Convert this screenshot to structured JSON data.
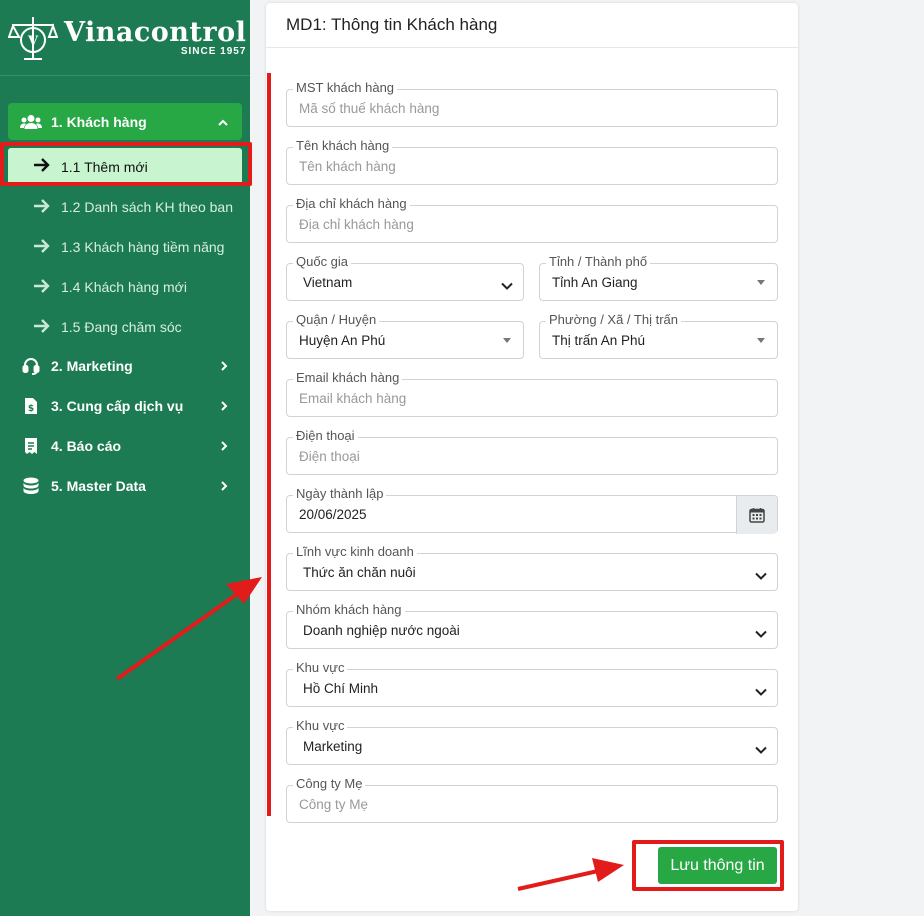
{
  "brand": {
    "name": "Vinacontrol",
    "since": "SINCE 1957"
  },
  "sidebar": {
    "groups": [
      {
        "label": "1. Khách hàng",
        "icon": "users-icon",
        "expanded": true
      },
      {
        "label": "2. Marketing",
        "icon": "headset-icon"
      },
      {
        "label": "3. Cung cấp dịch vụ",
        "icon": "invoice-icon"
      },
      {
        "label": "4. Báo cáo",
        "icon": "receipt-icon"
      },
      {
        "label": "5. Master Data",
        "icon": "database-icon"
      }
    ],
    "subitems": [
      {
        "label": "1.1 Thêm mới",
        "active": true
      },
      {
        "label": "1.2 Danh sách KH theo ban"
      },
      {
        "label": "1.3 Khách hàng tiềm năng"
      },
      {
        "label": "1.4 Khách hàng mới"
      },
      {
        "label": "1.5 Đang chăm sóc"
      }
    ]
  },
  "form": {
    "title": "MD1: Thông tin Khách hàng",
    "mst": {
      "label": "MST khách hàng",
      "placeholder": "Mã số thuế khách hàng"
    },
    "name": {
      "label": "Tên khách hàng",
      "placeholder": "Tên khách hàng"
    },
    "address": {
      "label": "Địa chỉ khách hàng",
      "placeholder": "Địa chỉ khách hàng"
    },
    "country": {
      "label": "Quốc gia",
      "value": "Vietnam"
    },
    "province": {
      "label": "Tỉnh / Thành phố",
      "value": "Tỉnh An Giang"
    },
    "district": {
      "label": "Quận / Huyện",
      "value": "Huyện An Phú"
    },
    "ward": {
      "label": "Phường / Xã / Thị trấn",
      "value": "Thị trấn An Phú"
    },
    "email": {
      "label": "Email khách hàng",
      "placeholder": "Email khách hàng"
    },
    "phone": {
      "label": "Điện thoại",
      "placeholder": "Điện thoại"
    },
    "founded": {
      "label": "Ngày thành lập",
      "value": "20/06/2025"
    },
    "industry": {
      "label": "Lĩnh vực kinh doanh",
      "value": "Thức ăn chăn nuôi"
    },
    "group": {
      "label": "Nhóm khách hàng",
      "value": "Doanh nghiệp nước ngoài"
    },
    "region": {
      "label": "Khu vực",
      "value": "Hồ Chí Minh"
    },
    "region2": {
      "label": "Khu vực",
      "value": "Marketing"
    },
    "parent": {
      "label": "Công ty Mẹ",
      "placeholder": "Công ty Mẹ"
    },
    "save_label": "Lưu thông tin"
  },
  "colors": {
    "sidebar": "#1c7b52",
    "accent": "#28a745",
    "annotation": "#e21b1b"
  }
}
